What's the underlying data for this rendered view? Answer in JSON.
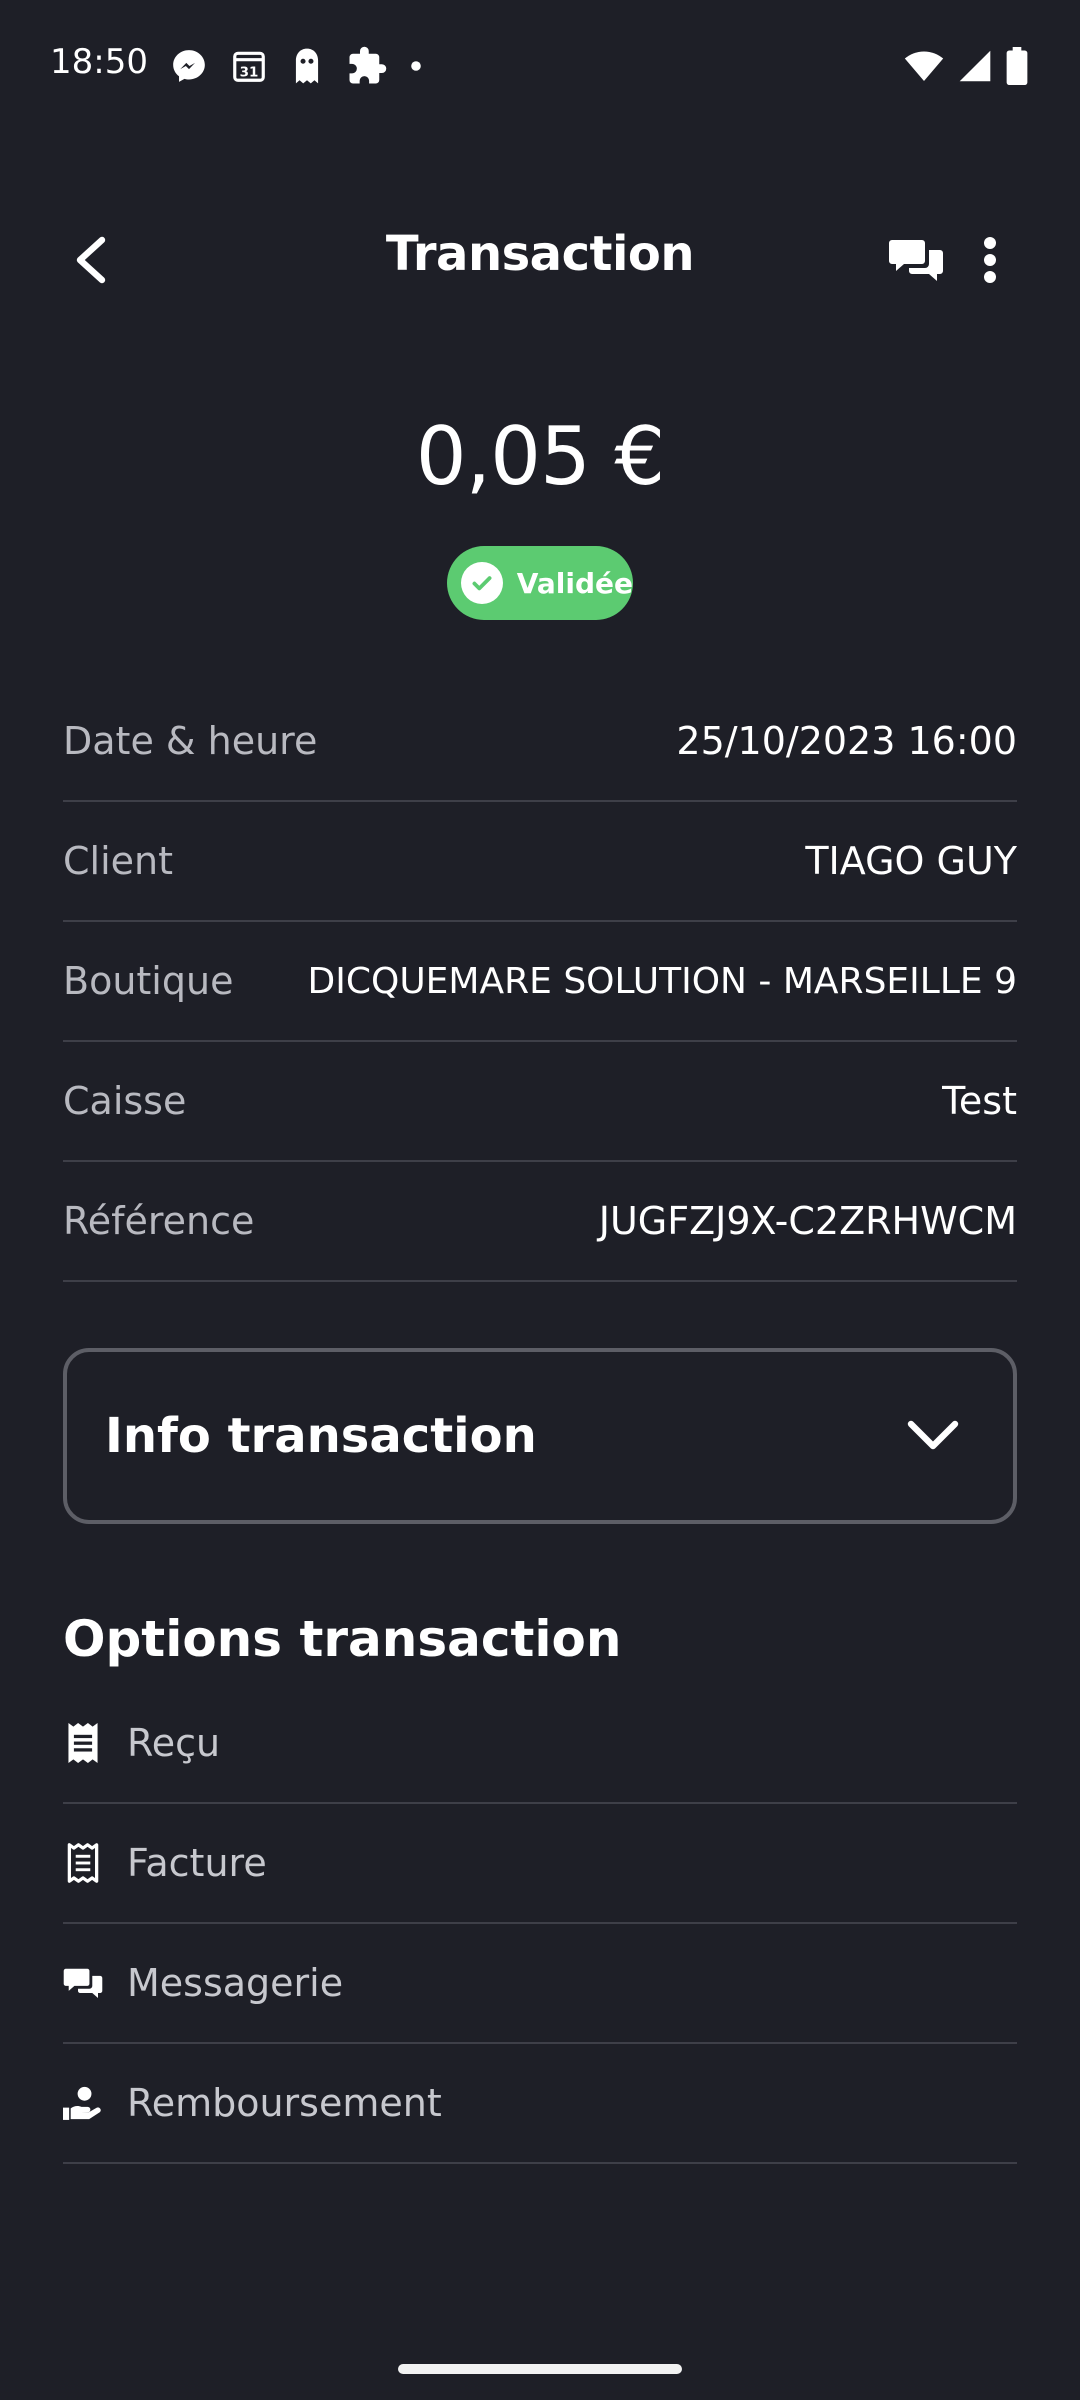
{
  "status_bar": {
    "time": "18:50",
    "left_icons": [
      "messenger-icon",
      "calendar-icon",
      "ghost-icon",
      "puzzle-icon",
      "dot-icon"
    ],
    "calendar_day": "31",
    "right_icons": [
      "wifi-icon",
      "signal-icon",
      "battery-icon"
    ]
  },
  "app_bar": {
    "title": "Transaction",
    "back_icon": "chevron-left-icon",
    "chat_icon": "chat-bubbles-icon",
    "more_icon": "more-vertical-icon"
  },
  "transaction": {
    "amount": "0,05 €",
    "status": "Validée",
    "status_color": "#5ccb71"
  },
  "details": [
    {
      "label": "Date & heure",
      "value": "25/10/2023 16:00"
    },
    {
      "label": "Client",
      "value": "TIAGO GUY"
    },
    {
      "label": "Boutique",
      "value": "DICQUEMARE SOLUTION - MARSEILLE 9"
    },
    {
      "label": "Caisse",
      "value": "Test"
    },
    {
      "label": "Référence",
      "value": "JUGFZJ9X-C2ZRHWCM"
    }
  ],
  "info_accordion": {
    "title": "Info transaction",
    "icon": "chevron-down-icon"
  },
  "options": {
    "title": "Options transaction",
    "items": [
      {
        "label": "Reçu",
        "icon": "receipt-icon"
      },
      {
        "label": "Facture",
        "icon": "invoice-icon"
      },
      {
        "label": "Messagerie",
        "icon": "chat-bubbles-icon"
      },
      {
        "label": "Remboursement",
        "icon": "refund-hand-icon"
      }
    ]
  },
  "colors": {
    "background": "#1e1f27",
    "divider": "#3e3f48",
    "label": "#b8b9c0"
  }
}
